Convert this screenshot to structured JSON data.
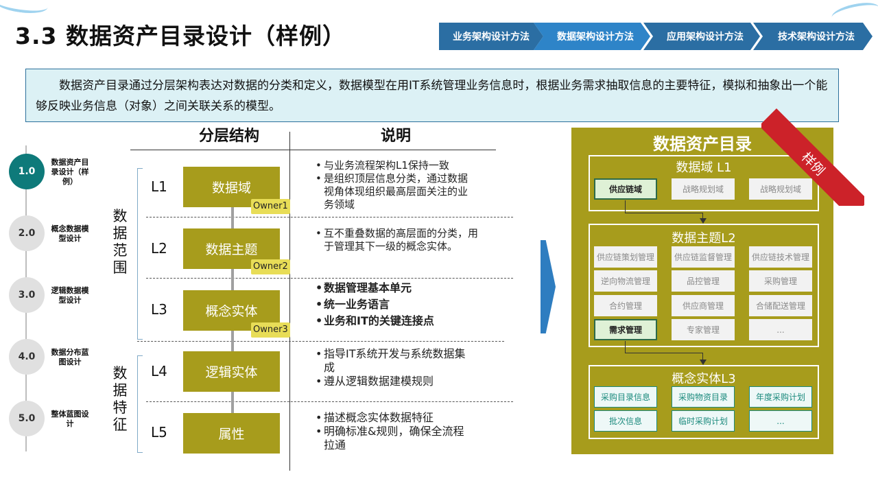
{
  "title": "3.3 数据资产目录设计（样例）",
  "nav": [
    {
      "label": "业务架构设计方法",
      "color": "#2b6ea3"
    },
    {
      "label": "数据架构设计方法",
      "color": "#2e84c8"
    },
    {
      "label": "应用架构设计方法",
      "color": "#2b6ea3"
    },
    {
      "label": "技术架构设计方法",
      "color": "#2b6ea3"
    }
  ],
  "intro": "数据资产目录通过分层架构表达对数据的分类和定义，数据模型在用IT系统管理业务信息时，根据业务需求抽取信息的主要特征，模拟和抽象出一个能够反映业务信息（对象）之间关联关系的模型。",
  "steps": [
    {
      "num": "1.0",
      "label": "数据资产目录设计（样例）",
      "active": true
    },
    {
      "num": "2.0",
      "label": "概念数据模型设计",
      "active": false
    },
    {
      "num": "3.0",
      "label": "逻辑数据模型设计",
      "active": false
    },
    {
      "num": "4.0",
      "label": "数据分布蓝图设计",
      "active": false
    },
    {
      "num": "5.0",
      "label": "整体蓝图设计",
      "active": false
    }
  ],
  "headers": {
    "layers": "分层结构",
    "desc": "说明"
  },
  "groups": {
    "scope": "数据范围",
    "feature": "数据特征"
  },
  "levels": [
    {
      "code": "L1",
      "name": "数据域",
      "owner": "Owner1"
    },
    {
      "code": "L2",
      "name": "数据主题",
      "owner": "Owner2"
    },
    {
      "code": "L3",
      "name": "概念实体",
      "owner": "Owner3"
    },
    {
      "code": "L4",
      "name": "逻辑实体",
      "owner": ""
    },
    {
      "code": "L5",
      "name": "属性",
      "owner": ""
    }
  ],
  "descriptions": {
    "l1": [
      "与业务流程架构L1保持一致",
      "是组织顶层信息分类，通过数据视角体现组织最高层面关注的业务领域"
    ],
    "l2": [
      "互不重叠数据的高层面的分类，用于管理其下一级的概念实体。"
    ],
    "l3": [
      "数据管理基本单元",
      "统一业务语言",
      "业务和IT的关键连接点"
    ],
    "l4": [
      "指导IT系统开发与系统数据集成",
      "遵从逻辑数据建模规则"
    ],
    "l5": [
      "描述概念实体数据特征",
      "明确标准&规则，确保全流程拉通"
    ]
  },
  "catalog": {
    "title": "数据资产目录",
    "ribbon": "样例",
    "domain": {
      "title": "数据域  L1",
      "items": [
        "供应链域",
        "战略规划域",
        "战略规划域"
      ]
    },
    "subject": {
      "title": "数据主题L2",
      "items": [
        "供应链策划管理",
        "供应链监督管理",
        "供应链技术管理",
        "逆向物流管理",
        "品控管理",
        "采购管理",
        "合约管理",
        "供应商管理",
        "合储配送管理",
        "需求管理",
        "专家管理",
        "..."
      ]
    },
    "entity": {
      "title": "概念实体L3",
      "items": [
        "采购目录信息",
        "采购物资目录",
        "年度采购计划",
        "批次信息",
        "临时采购计划",
        "..."
      ]
    }
  },
  "colors": {
    "olive": "#a79c1c",
    "owner": "#e8dd57",
    "teal": "#0e7a7a",
    "ribbon": "#cc2229",
    "accent_blue": "#2e7dc0"
  }
}
